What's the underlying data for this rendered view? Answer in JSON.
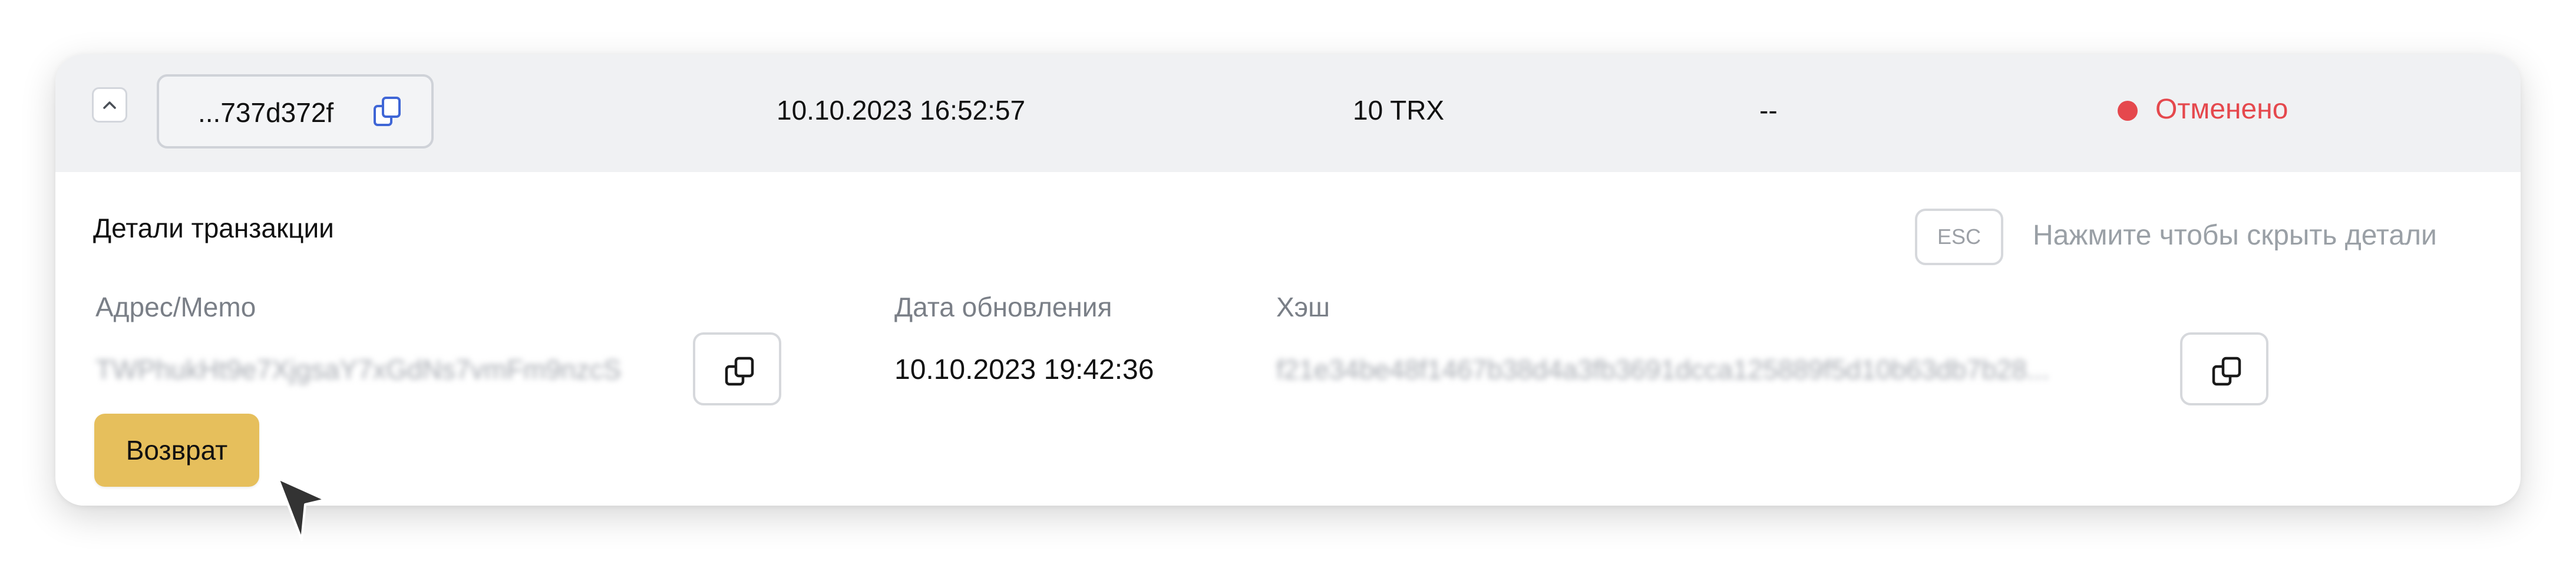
{
  "transaction": {
    "id_short": "...737d372f",
    "date": "10.10.2023 16:52:57",
    "amount": "10 TRX",
    "extra": "--",
    "status": "Отменено"
  },
  "details": {
    "title": "Детали транзакции",
    "esc_key": "ESC",
    "esc_hint": "Нажмите чтобы скрыть детали",
    "address_label": "Адрес/Memo",
    "address_value": "TWPhukHt9e7XjgsaY7xGdNs7vmFm9nzcS",
    "updated_label": "Дата обновления",
    "updated_value": "10.10.2023 19:42:36",
    "hash_label": "Хэш",
    "hash_value": "f21e34be48f1467b38d4a3fb3691dcca125889f5d10b63db7b28...",
    "refund_label": "Возврат"
  },
  "icons": {
    "collapse": "chevron-up-icon",
    "copy": "copy-icon",
    "cursor": "mouse-pointer-icon"
  },
  "colors": {
    "header_bg": "#f0f1f3",
    "status_cancelled": "#e5484d",
    "copy_icon_accent": "#3f66d6",
    "refund_button": "#e6bf5c"
  }
}
